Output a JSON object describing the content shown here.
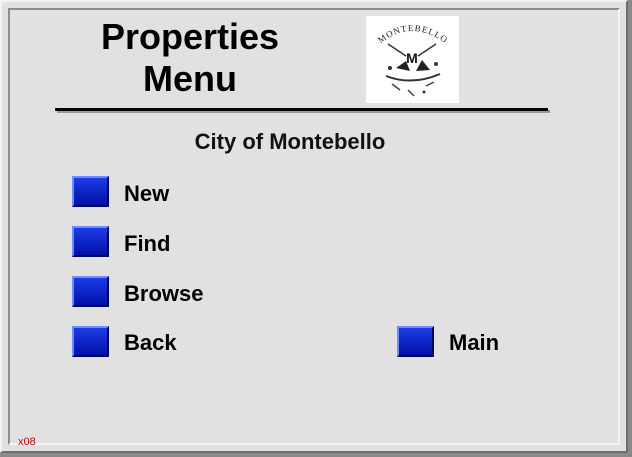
{
  "header": {
    "title_line1": "Properties",
    "title_line2": "Menu",
    "logo_text": "MONTEBELLO",
    "logo_initial": "M",
    "logo_icon": "city-seal-icon"
  },
  "subtitle": "City of Montebello",
  "buttons": {
    "new_label": "New",
    "find_label": "Find",
    "browse_label": "Browse",
    "back_label": "Back",
    "main_label": "Main"
  },
  "footer": {
    "code": "x08"
  },
  "colors": {
    "button_blue": "#0a22c8",
    "background": "#e1e1e1",
    "code_red": "#d40000"
  }
}
